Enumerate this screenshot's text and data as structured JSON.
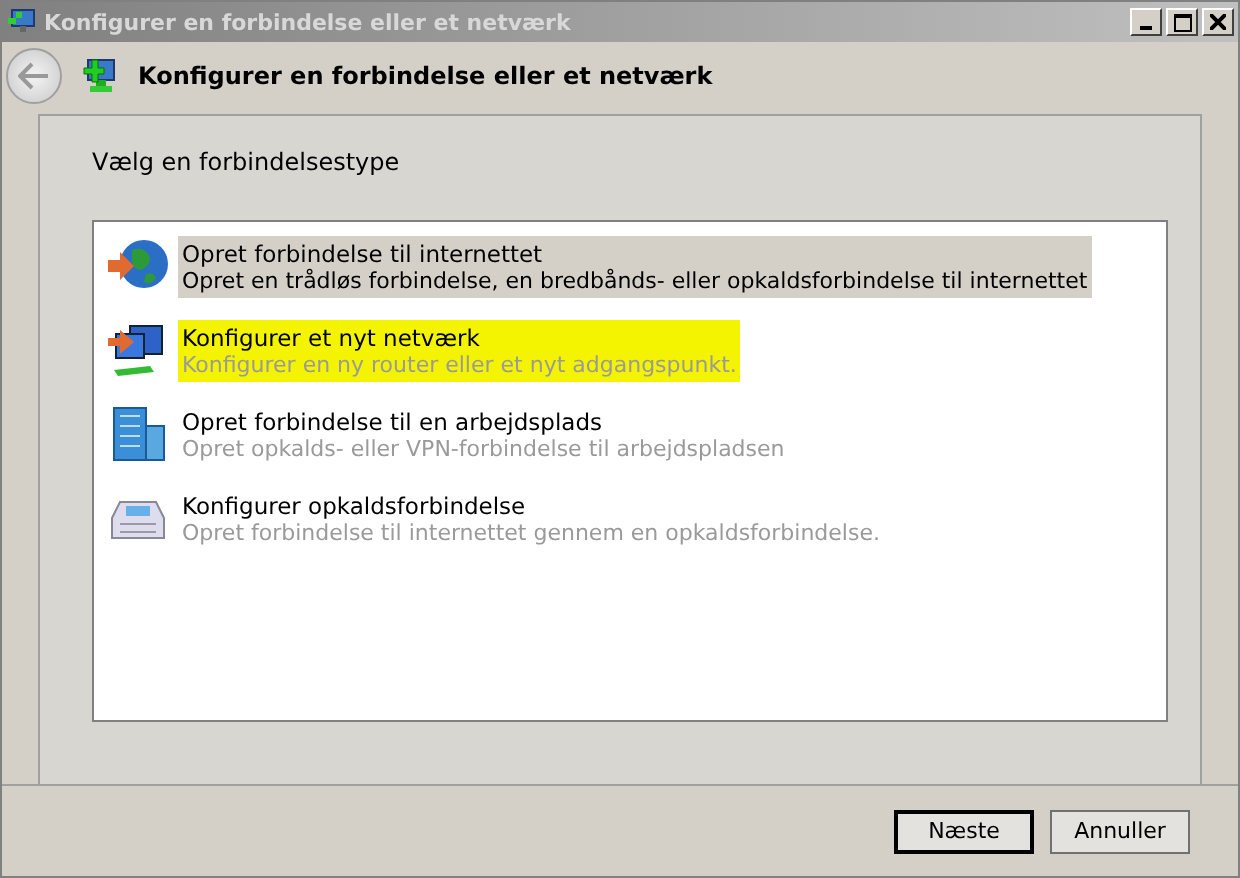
{
  "window": {
    "title": "Konfigurer en forbindelse eller et netværk"
  },
  "header": {
    "title": "Konfigurer en forbindelse eller et netværk"
  },
  "prompt": "Vælg en forbindelsestype",
  "options": [
    {
      "kind": "internet",
      "title": "Opret forbindelse til internettet",
      "description": "Opret en trådløs forbindelse, en bredbånds- eller opkaldsforbindelse til internettet",
      "selected": true,
      "marked": false
    },
    {
      "kind": "network",
      "title": "Konfigurer et nyt netværk",
      "description": "Konfigurer en ny router eller et nyt adgangspunkt.",
      "selected": false,
      "marked": true
    },
    {
      "kind": "workplace",
      "title": "Opret forbindelse til en arbejdsplads",
      "description": "Opret opkalds- eller VPN-forbindelse til arbejdspladsen",
      "selected": false,
      "marked": false
    },
    {
      "kind": "dialup",
      "title": "Konfigurer opkaldsforbindelse",
      "description": "Opret forbindelse til internettet gennem en opkaldsforbindelse.",
      "selected": false,
      "marked": false
    }
  ],
  "buttons": [
    {
      "label": "Næste",
      "default": true
    },
    {
      "label": "Annuller",
      "default": false
    }
  ]
}
